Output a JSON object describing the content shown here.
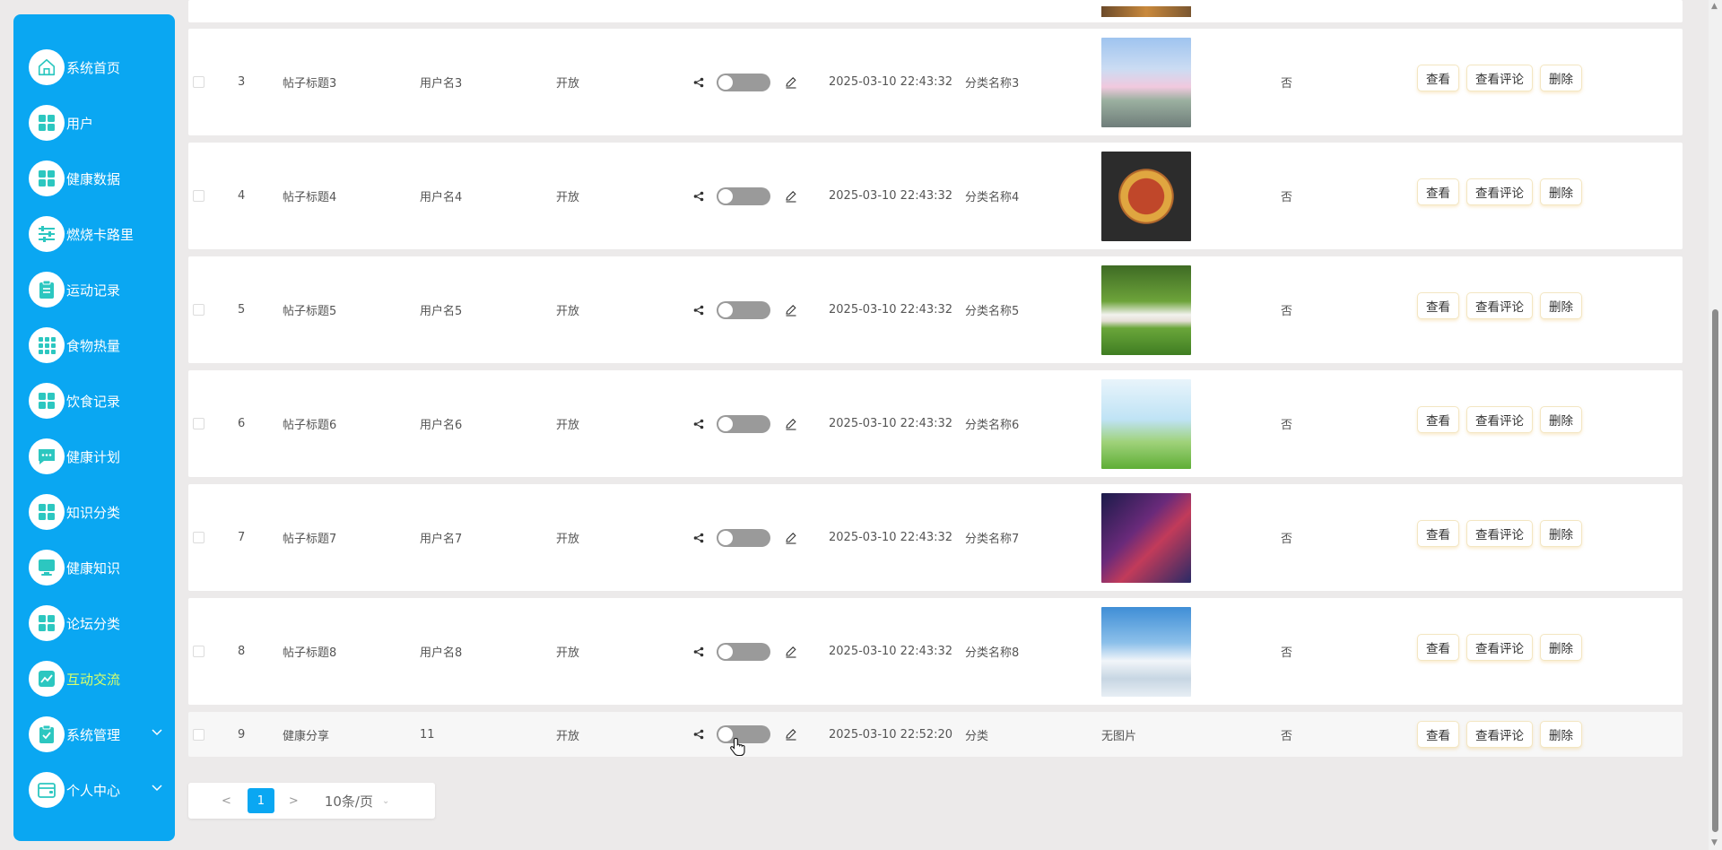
{
  "sidebar": {
    "accent": "#0aa7f2",
    "items": [
      {
        "label": "系统首页",
        "icon": "home-icon"
      },
      {
        "label": "用户",
        "icon": "grid-icon"
      },
      {
        "label": "健康数据",
        "icon": "grid-icon"
      },
      {
        "label": "燃烧卡路里",
        "icon": "sliders-icon"
      },
      {
        "label": "运动记录",
        "icon": "clipboard-icon"
      },
      {
        "label": "食物热量",
        "icon": "apps-icon"
      },
      {
        "label": "饮食记录",
        "icon": "grid-icon"
      },
      {
        "label": "健康计划",
        "icon": "chat-icon"
      },
      {
        "label": "知识分类",
        "icon": "grid-icon"
      },
      {
        "label": "健康知识",
        "icon": "monitor-icon"
      },
      {
        "label": "论坛分类",
        "icon": "grid-icon"
      },
      {
        "label": "互动交流",
        "icon": "chart-icon",
        "active": true
      },
      {
        "label": "系统管理",
        "icon": "clipboard-check-icon",
        "expandable": true
      },
      {
        "label": "个人中心",
        "icon": "wallet-icon",
        "expandable": true
      }
    ]
  },
  "table": {
    "buttons": {
      "view": "查看",
      "view_comments": "查看评论",
      "delete": "删除"
    },
    "rows": [
      {
        "index": "3",
        "title": "帖子标题3",
        "user": "用户名3",
        "status": "开放",
        "time": "2025-03-10 22:43:32",
        "category": "分类名称3",
        "image": "anime-railway",
        "flag": "否"
      },
      {
        "index": "4",
        "title": "帖子标题4",
        "user": "用户名4",
        "status": "开放",
        "time": "2025-03-10 22:43:32",
        "category": "分类名称4",
        "image": "pizza",
        "flag": "否"
      },
      {
        "index": "5",
        "title": "帖子标题5",
        "user": "用户名5",
        "status": "开放",
        "time": "2025-03-10 22:43:32",
        "category": "分类名称5",
        "image": "yoga-grass",
        "flag": "否"
      },
      {
        "index": "6",
        "title": "帖子标题6",
        "user": "用户名6",
        "status": "开放",
        "time": "2025-03-10 22:43:32",
        "category": "分类名称6",
        "image": "green-field",
        "flag": "否"
      },
      {
        "index": "7",
        "title": "帖子标题7",
        "user": "用户名7",
        "status": "开放",
        "time": "2025-03-10 22:43:32",
        "category": "分类名称7",
        "image": "neon-robots",
        "flag": "否"
      },
      {
        "index": "8",
        "title": "帖子标题8",
        "user": "用户名8",
        "status": "开放",
        "time": "2025-03-10 22:43:32",
        "category": "分类名称8",
        "image": "snow-mountain",
        "flag": "否"
      },
      {
        "index": "9",
        "title": "健康分享",
        "user": "11",
        "status": "开放",
        "time": "2025-03-10 22:52:20",
        "category": "分类",
        "image_text": "无图片",
        "flag": "否"
      }
    ]
  },
  "pagination": {
    "prev": "<",
    "current": "1",
    "next": ">",
    "page_size": "10条/页"
  }
}
